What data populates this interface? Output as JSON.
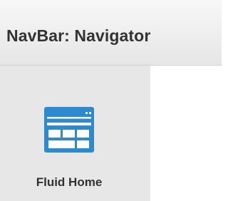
{
  "header": {
    "title": "NavBar: Navigator"
  },
  "tiles": [
    {
      "label": "Fluid Home",
      "icon": "fluid-home-icon",
      "icon_color": "#2b8ad0"
    }
  ]
}
